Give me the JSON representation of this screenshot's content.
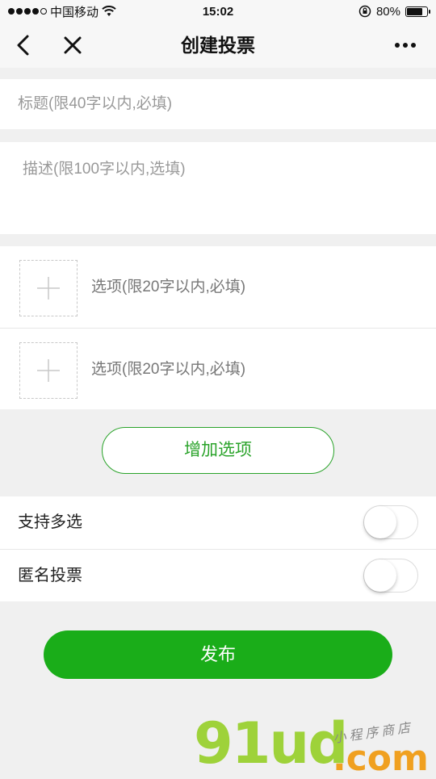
{
  "status_bar": {
    "carrier": "中国移动",
    "time": "15:02",
    "battery": "80%",
    "battery_level": 0.8
  },
  "nav": {
    "title": "创建投票",
    "back_icon": "chevron-left-icon",
    "close_icon": "close-icon",
    "more_icon": "more-dots-icon"
  },
  "form": {
    "title_placeholder": "标题(限40字以内,必填)",
    "desc_placeholder": "描述(限100字以内,选填)",
    "options": [
      {
        "placeholder": "选项(限20字以内,必填)"
      },
      {
        "placeholder": "选项(限20字以内,必填)"
      }
    ],
    "add_option_label": "增加选项",
    "multi_select_label": "支持多选",
    "anonymous_label": "匿名投票",
    "multi_select_on": false,
    "anonymous_on": false,
    "publish_label": "发布"
  },
  "watermark": {
    "brand": "91ud",
    "domain": ".com",
    "tagline": "小程序商店"
  },
  "colors": {
    "accent": "#1aad19",
    "accent_border": "#2aa32a",
    "placeholder": "#999999",
    "background": "#f0f0f0"
  }
}
